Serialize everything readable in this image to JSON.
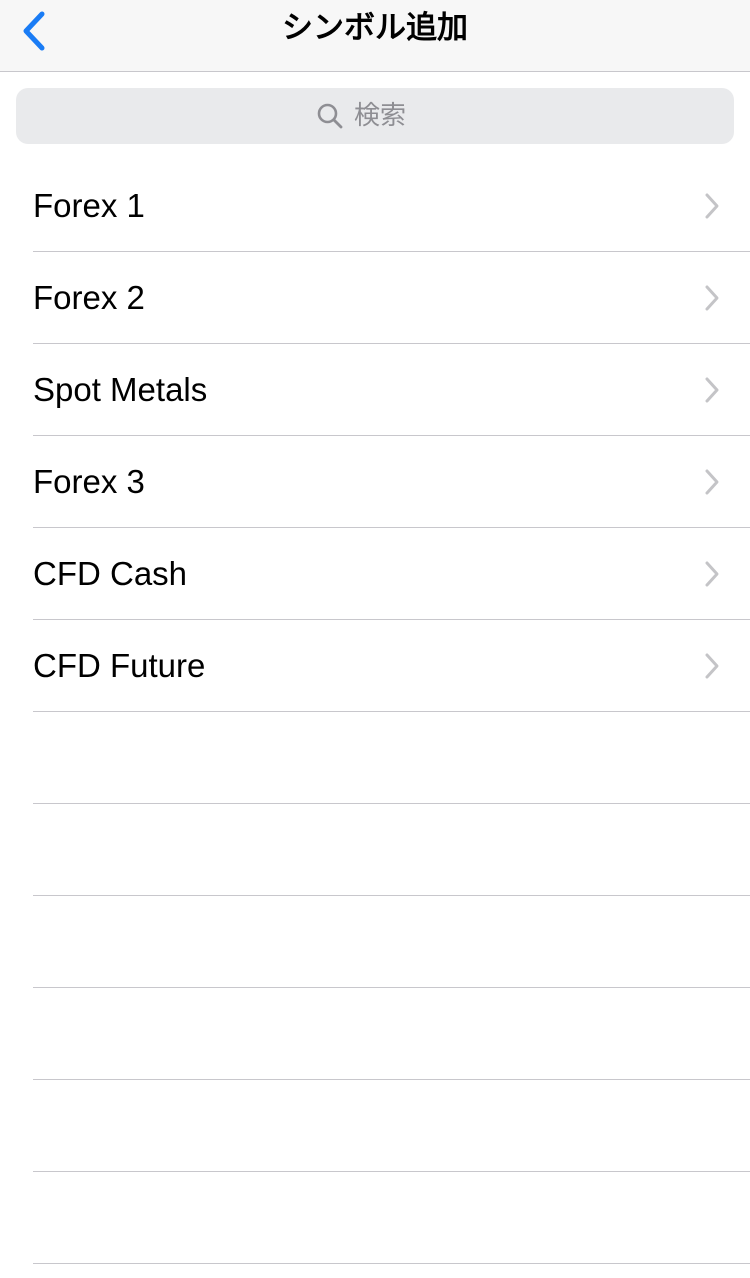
{
  "nav": {
    "title": "シンボル追加",
    "back_icon": "chevron-left-icon",
    "accent_color": "#1a7cf5"
  },
  "search": {
    "placeholder": "検索",
    "value": "",
    "icon": "search-icon"
  },
  "list": {
    "items": [
      {
        "label": "Forex 1"
      },
      {
        "label": "Forex 2"
      },
      {
        "label": "Spot Metals"
      },
      {
        "label": "Forex 3"
      },
      {
        "label": "CFD Cash"
      },
      {
        "label": "CFD Future"
      }
    ],
    "chevron_icon": "chevron-right-icon"
  }
}
